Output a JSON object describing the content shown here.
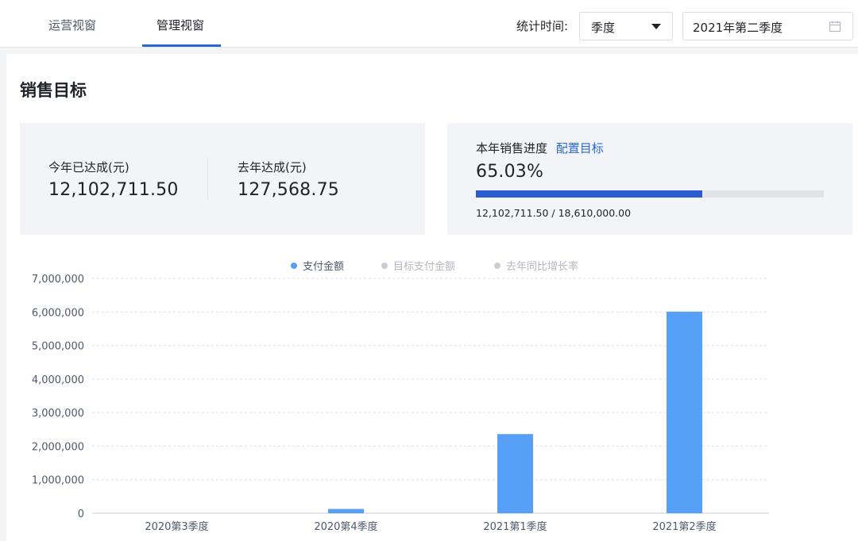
{
  "tabs": [
    {
      "label": "运营视窗",
      "active": false
    },
    {
      "label": "管理视窗",
      "active": true
    }
  ],
  "filter": {
    "label": "统计时间:",
    "period_select": "季度",
    "date_value": "2021年第二季度"
  },
  "section": {
    "title": "销售目标"
  },
  "kpi": {
    "this_year_label": "今年已达成(元)",
    "this_year_value": "12,102,711.50",
    "last_year_label": "去年达成(元)",
    "last_year_value": "127,568.75"
  },
  "progress": {
    "label": "本年销售进度",
    "config_link": "配置目标",
    "percent_text": "65.03%",
    "fraction": 0.6503,
    "detail": "12,102,711.50 / 18,610,000.00"
  },
  "colors": {
    "accent": "#2a68d6",
    "bar": "#56a0f7",
    "legend_inactive": "#c9cdd4"
  },
  "chart_data": {
    "type": "bar",
    "categories": [
      "2020第3季度",
      "2020第4季度",
      "2021第1季度",
      "2021第2季度"
    ],
    "series": [
      {
        "name": "支付金额",
        "values": [
          0,
          127568.75,
          2360000,
          6010000
        ],
        "active": true
      },
      {
        "name": "目标支付金额",
        "values": [],
        "active": false
      },
      {
        "name": "去年同比增长率",
        "values": [],
        "active": false
      }
    ],
    "yticks": [
      "7,000,000",
      "6,000,000",
      "5,000,000",
      "4,000,000",
      "3,000,000",
      "2,000,000",
      "1,000,000",
      "0"
    ],
    "ylim": [
      0,
      7000000
    ],
    "grid": true,
    "legend_position": "top-center"
  }
}
